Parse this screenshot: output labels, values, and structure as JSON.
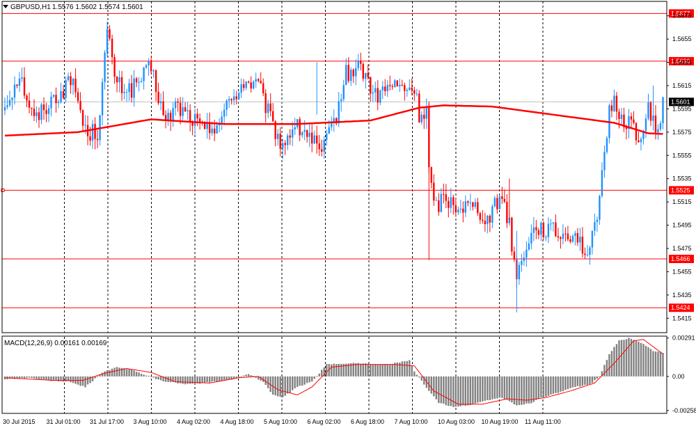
{
  "symbol": {
    "name": "GBPUSD,H1",
    "ohlc": "1.5576 1.5602 1.5574 1.5601"
  },
  "chart_data": [
    {
      "type": "candlestick",
      "title": "GBPUSD,H1",
      "ylim": [
        1.5405,
        1.5685
      ],
      "y_ticks": [
        "1.5675",
        "1.5655",
        "1.5635",
        "1.5615",
        "1.5595",
        "1.5575",
        "1.5555",
        "1.5535",
        "1.5515",
        "1.5495",
        "1.5475",
        "1.5455",
        "1.5435",
        "1.5415"
      ],
      "x_ticks": [
        "30 Jul 2015",
        "31 Jul 01:00",
        "31 Jul 17:00",
        "3 Aug 10:00",
        "4 Aug 02:00",
        "4 Aug 18:00",
        "5 Aug 10:00",
        "6 Aug 02:00",
        "6 Aug 18:00",
        "7 Aug 10:00",
        "10 Aug 03:00",
        "10 Aug 19:00",
        "11 Aug 11:00"
      ],
      "levels": [
        {
          "value": 1.5677,
          "label": "1.5677"
        },
        {
          "value": 1.5636,
          "label": "1.5636"
        },
        {
          "value": 1.5525,
          "label": "1.5525"
        },
        {
          "value": 1.5466,
          "label": "1.5466"
        },
        {
          "value": 1.5424,
          "label": "1.5424"
        }
      ],
      "current_price": {
        "value": 1.5601,
        "label": "1.5601"
      },
      "moving_average_anchors": [
        [
          0,
          1.5572
        ],
        [
          30,
          1.5575
        ],
        [
          60,
          1.5586
        ],
        [
          90,
          1.5582
        ],
        [
          120,
          1.5582
        ],
        [
          150,
          1.5585
        ],
        [
          170,
          1.5596
        ],
        [
          180,
          1.5598
        ],
        [
          200,
          1.5597
        ],
        [
          250,
          1.5583
        ],
        [
          264,
          1.5574
        ],
        [
          275,
          1.5573
        ]
      ],
      "candle_segments": [
        [
          0,
          1.5598
        ],
        [
          6,
          1.5625
        ],
        [
          12,
          1.5585
        ],
        [
          18,
          1.56
        ],
        [
          28,
          1.562
        ],
        [
          33,
          1.5575
        ],
        [
          38,
          1.5575
        ],
        [
          42,
          1.566
        ],
        [
          46,
          1.5615
        ],
        [
          52,
          1.5612
        ],
        [
          60,
          1.563
        ],
        [
          66,
          1.5582
        ],
        [
          70,
          1.5598
        ],
        [
          78,
          1.5585
        ],
        [
          82,
          1.5575
        ],
        [
          88,
          1.5585
        ],
        [
          92,
          1.56
        ],
        [
          98,
          1.5618
        ],
        [
          104,
          1.5615
        ],
        [
          110,
          1.558
        ],
        [
          114,
          1.5563
        ],
        [
          118,
          1.558
        ],
        [
          124,
          1.5575
        ],
        [
          130,
          1.5555
        ],
        [
          136,
          1.559
        ],
        [
          140,
          1.5625
        ],
        [
          146,
          1.5632
        ],
        [
          152,
          1.5605
        ],
        [
          158,
          1.5615
        ],
        [
          164,
          1.5612
        ],
        [
          168,
          1.5612
        ],
        [
          170,
          1.559
        ],
        [
          173,
          1.5592
        ],
        [
          174,
          1.5545
        ],
        [
          176,
          1.551
        ],
        [
          180,
          1.5518
        ],
        [
          186,
          1.5512
        ],
        [
          190,
          1.5512
        ],
        [
          194,
          1.551
        ],
        [
          198,
          1.55
        ],
        [
          204,
          1.5522
        ],
        [
          207,
          1.5495
        ],
        [
          210,
          1.545
        ],
        [
          214,
          1.548
        ],
        [
          218,
          1.5494
        ],
        [
          224,
          1.549
        ],
        [
          230,
          1.5486
        ],
        [
          234,
          1.549
        ],
        [
          238,
          1.5472
        ],
        [
          240,
          1.547
        ],
        [
          244,
          1.552
        ],
        [
          246,
          1.555
        ],
        [
          248,
          1.5595
        ],
        [
          250,
          1.56
        ],
        [
          254,
          1.5585
        ],
        [
          258,
          1.5582
        ],
        [
          261,
          1.5562
        ],
        [
          264,
          1.5598
        ],
        [
          268,
          1.5575
        ],
        [
          270,
          1.5601
        ]
      ]
    },
    {
      "type": "histogram",
      "title": "MACD(12,26,9) 0.00161 0.00169",
      "ylim": [
        -0.0028,
        0.003
      ],
      "y_ticks": [
        "0.00291",
        "0.00",
        "-0.00258"
      ],
      "macd_segments": [
        [
          0,
          -0.0002
        ],
        [
          10,
          -0.0001
        ],
        [
          18,
          -0.0003
        ],
        [
          26,
          -0.0004
        ],
        [
          33,
          -0.0008
        ],
        [
          40,
          0.0003
        ],
        [
          46,
          0.0007
        ],
        [
          52,
          0.0005
        ],
        [
          58,
          0.0001
        ],
        [
          62,
          -0.0002
        ],
        [
          66,
          -0.0004
        ],
        [
          76,
          -0.0006
        ],
        [
          86,
          -0.0004
        ],
        [
          94,
          -0.0002
        ],
        [
          100,
          0.0002
        ],
        [
          106,
          -0.0004
        ],
        [
          110,
          -0.0014
        ],
        [
          114,
          -0.0016
        ],
        [
          120,
          -0.0008
        ],
        [
          126,
          -0.0004
        ],
        [
          132,
          0.0009
        ],
        [
          140,
          0.001
        ],
        [
          148,
          0.001
        ],
        [
          154,
          0.0009
        ],
        [
          160,
          0.001
        ],
        [
          166,
          0.0012
        ],
        [
          168,
          0.0004
        ],
        [
          172,
          -0.0006
        ],
        [
          178,
          -0.002
        ],
        [
          184,
          -0.0023
        ],
        [
          190,
          -0.0022
        ],
        [
          198,
          -0.0018
        ],
        [
          204,
          -0.0016
        ],
        [
          210,
          -0.0022
        ],
        [
          216,
          -0.002
        ],
        [
          220,
          -0.0016
        ],
        [
          226,
          -0.0013
        ],
        [
          234,
          -0.0008
        ],
        [
          240,
          -0.0006
        ],
        [
          244,
          0.0
        ],
        [
          248,
          0.0017
        ],
        [
          252,
          0.0027
        ],
        [
          256,
          0.0029
        ],
        [
          262,
          0.0025
        ],
        [
          266,
          0.0019
        ],
        [
          270,
          0.0018
        ]
      ],
      "signal_anchors": [
        [
          0,
          -0.0001
        ],
        [
          20,
          -0.0003
        ],
        [
          32,
          -0.0003
        ],
        [
          40,
          0.0002
        ],
        [
          50,
          0.0006
        ],
        [
          60,
          0.0003
        ],
        [
          70,
          -0.0004
        ],
        [
          84,
          -0.0005
        ],
        [
          96,
          -0.0001
        ],
        [
          104,
          0.0
        ],
        [
          112,
          -0.001
        ],
        [
          120,
          -0.0014
        ],
        [
          126,
          -0.0008
        ],
        [
          134,
          0.0007
        ],
        [
          144,
          0.0009
        ],
        [
          160,
          0.0009
        ],
        [
          168,
          0.0008
        ],
        [
          176,
          -0.0011
        ],
        [
          186,
          -0.0021
        ],
        [
          196,
          -0.0021
        ],
        [
          206,
          -0.0017
        ],
        [
          214,
          -0.0018
        ],
        [
          222,
          -0.0016
        ],
        [
          232,
          -0.0011
        ],
        [
          242,
          -0.0005
        ],
        [
          250,
          0.001
        ],
        [
          258,
          0.0027
        ],
        [
          262,
          0.0028
        ],
        [
          270,
          0.0017
        ]
      ]
    }
  ],
  "colors": {
    "background": "#ffffff",
    "bull": "#1e90ff",
    "bear": "#ff0000",
    "moving_average": "#ff0000",
    "level_line": "#ff0000",
    "grid": "#000000",
    "current_price_bg": "#000000",
    "histogram": "#808080",
    "signal": "#ff0000"
  }
}
